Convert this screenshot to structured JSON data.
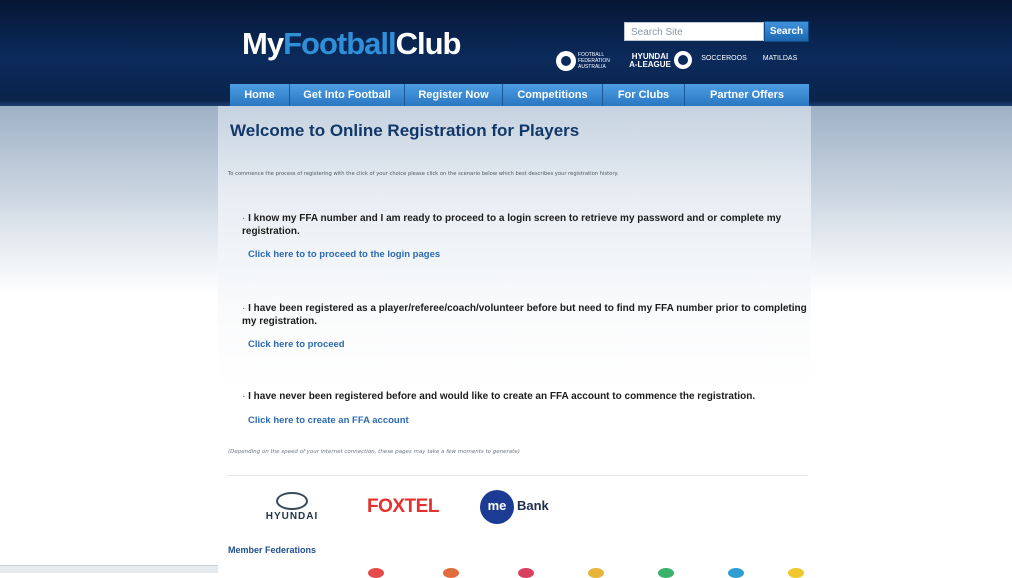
{
  "header": {
    "logo_part1": "My",
    "logo_part2": "Football",
    "logo_part3": "Club",
    "search_placeholder": "Search Site",
    "search_button": "Search",
    "brands": {
      "ffa": "FOOTBALL FEDERATION AUSTRALIA",
      "aleague": "HYUNDAI A-LEAGUE",
      "socceroos": "SOCCEROOS",
      "matildas": "MATILDAS"
    }
  },
  "nav": {
    "items": [
      {
        "label": "Home"
      },
      {
        "label": "Get Into Football"
      },
      {
        "label": "Register Now"
      },
      {
        "label": "Competitions"
      },
      {
        "label": "For Clubs"
      },
      {
        "label": "Partner Offers"
      }
    ]
  },
  "main": {
    "title": "Welcome to Online Registration for Players",
    "intro": "To commence the process of registering with the click of your choice please click on the scenario below which best describes your registration history.",
    "options": [
      {
        "text": "I know my FFA number and I am ready to proceed to a login screen to retrieve my password and or complete my registration.",
        "link": "Click here to to proceed to the login pages"
      },
      {
        "text": "I have been registered as a player/referee/coach/volunteer before but need to find my FFA number prior to completing my registration.",
        "link": "Click here to proceed"
      },
      {
        "text": "I have never been registered before and would like to create an FFA account to commence the registration.",
        "link": "Click here to create an FFA account"
      }
    ],
    "note": "(Depending on the speed of your internet connection, these pages may take a few moments to generate)"
  },
  "sponsors": {
    "hyundai": "HYUNDAI",
    "foxtel": "FOXTEL",
    "me": "me",
    "bank": "Bank"
  },
  "footer": {
    "member_federations": "Member Federations"
  },
  "colors": {
    "header_bg": "#0b2b5c",
    "nav_bg": "#3a8ad4",
    "title": "#12386a",
    "link": "#2b6ab0",
    "foxtel": "#e3322e",
    "mebank": "#1b3c92"
  }
}
